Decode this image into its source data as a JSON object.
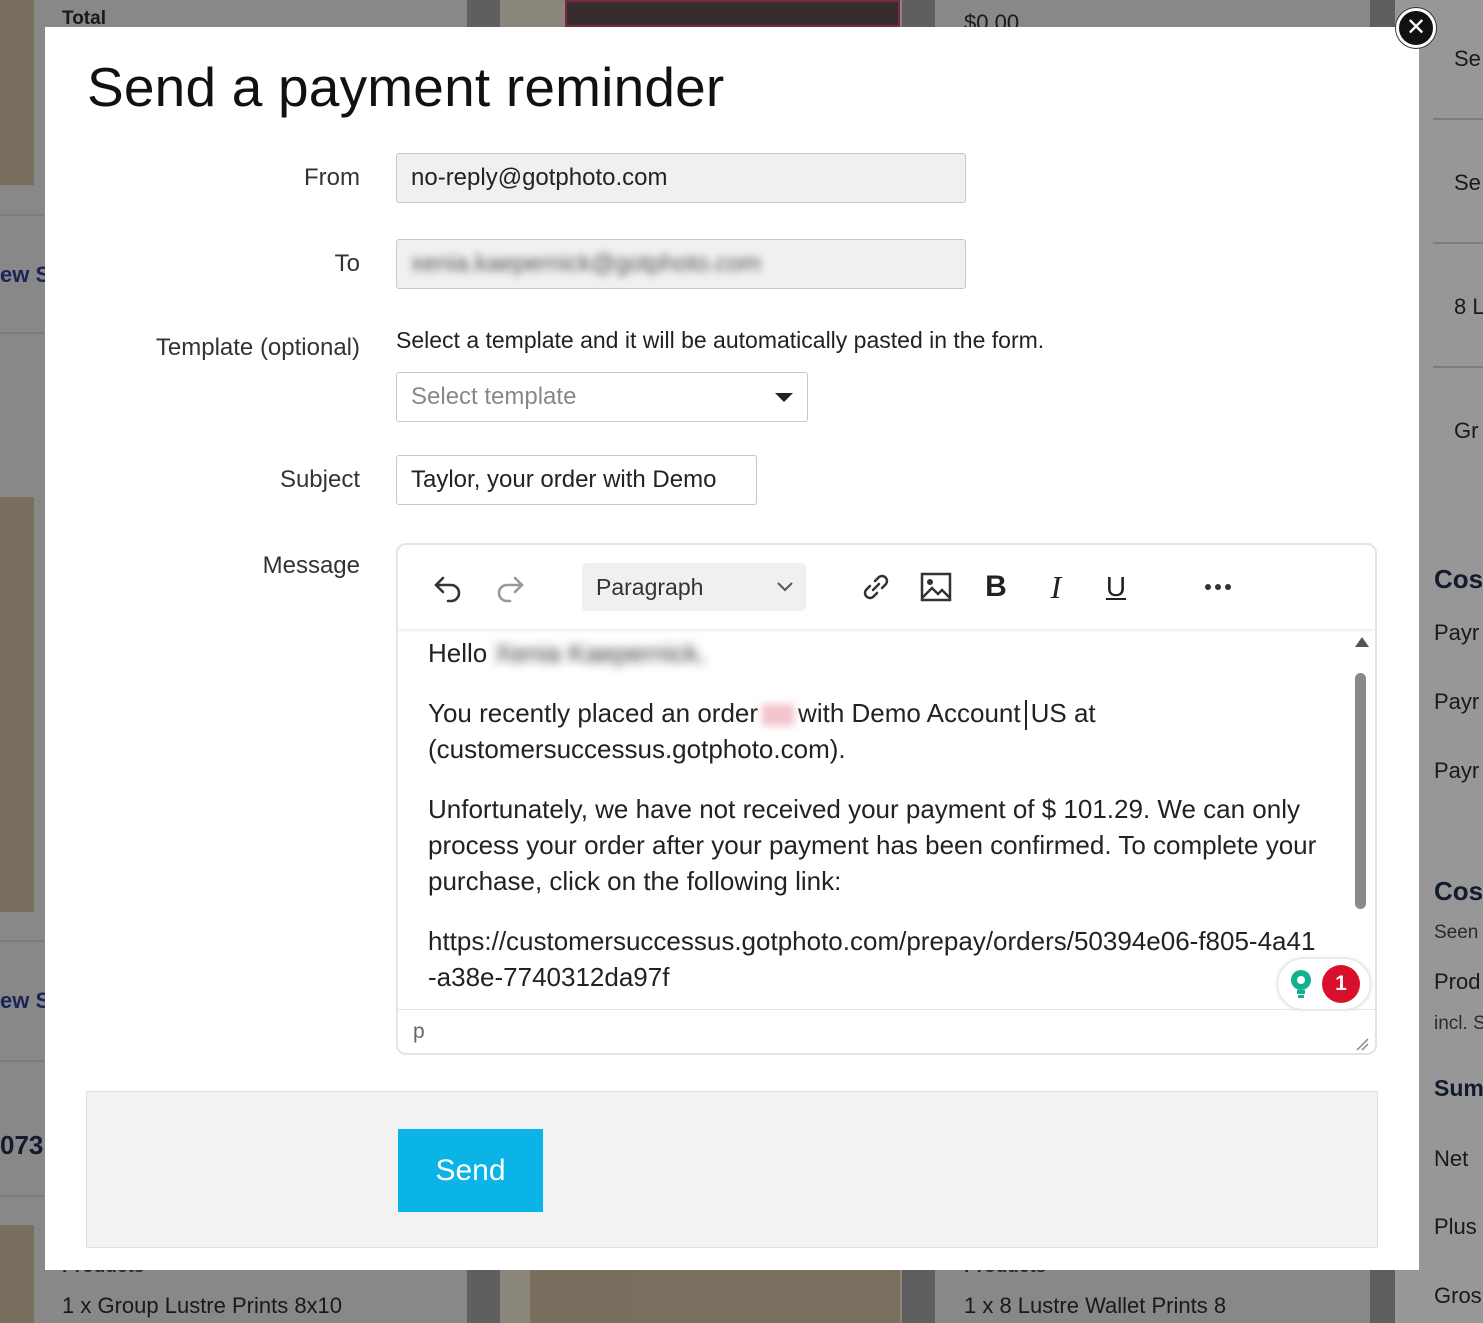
{
  "background": {
    "total_label": "Total",
    "price_text": "$0.00",
    "new_link_1": "ew S",
    "new_link_2": "ew S",
    "order_fragment": "073",
    "products_label_1": "Products",
    "products_label_2": "Products",
    "product_left": "1 x Group Lustre Prints 8x10",
    "product_right": "1 x 8 Lustre Wallet Prints 8",
    "right_items": [
      "Se",
      "Se",
      "8 L",
      "Gr"
    ],
    "right_heading_1": "Cos",
    "right_payments": [
      "Payr",
      "Payr",
      "Payr"
    ],
    "right_heading_2": "Cos",
    "right_seen": "Seen",
    "right_prod": "Prod",
    "right_incl": "incl. S",
    "right_heading_3": "Sum",
    "right_net": "Net",
    "right_plus": "Plus",
    "right_gros": "Gros"
  },
  "modal": {
    "title": "Send a payment reminder",
    "close_symbol": "✕",
    "from_label": "From",
    "from_value": "no-reply@gotphoto.com",
    "to_label": "To",
    "to_value": "xenia.kaepernick@gotphoto.com",
    "template_label": "Template (optional)",
    "template_hint": "Select a template and it will be automatically pasted in the form.",
    "template_placeholder": "Select template",
    "subject_label": "Subject",
    "subject_value": "Taylor, your order with Demo",
    "message_label": "Message",
    "editor": {
      "block_format": "Paragraph",
      "greeting": "Hello",
      "greeting_name": "Xenia Kaepernick,",
      "line2_a": "You recently placed an order",
      "line2_b": "with Demo Account",
      "line2_c": "US at",
      "line2_d": "(customersuccessus.gotphoto.com).",
      "para3": "Unfortunately, we have not received your payment of $ 101.29. We can only process your order after your payment has been confirmed. To complete your purchase, click on the following link:",
      "link": "https://customersuccessus.gotphoto.com/prepay/orders/50394e06-f805-4a41-a38e-7740312da97f",
      "status_path": "p",
      "grammar_count": "1"
    },
    "send_label": "Send"
  }
}
